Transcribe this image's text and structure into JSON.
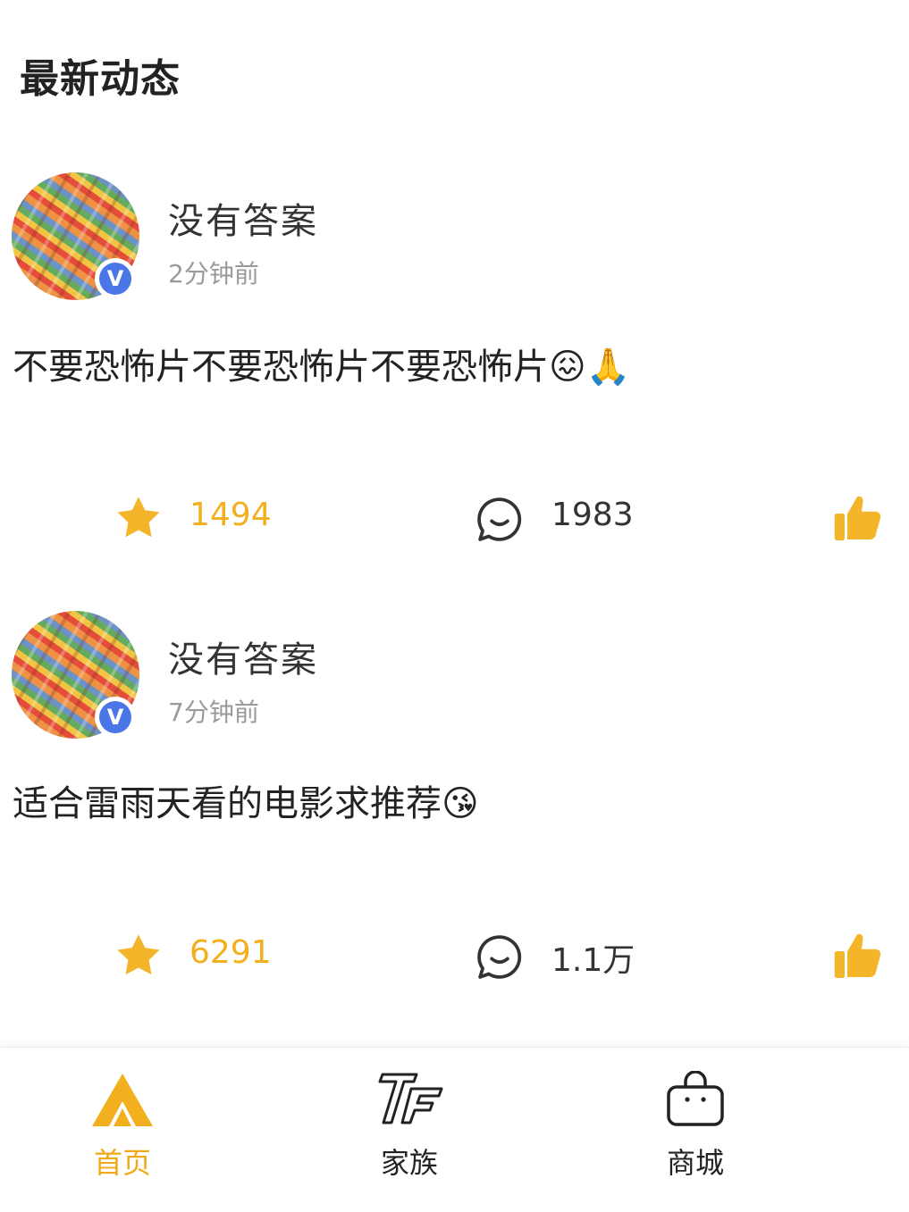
{
  "header": {
    "title": "最新动态"
  },
  "posts": [
    {
      "username": "没有答案",
      "time": "2分钟前",
      "text": "不要恐怖片不要恐怖片不要恐怖片😖🙏",
      "likes": "1494",
      "comments": "1983"
    },
    {
      "username": "没有答案",
      "time": "7分钟前",
      "text": "适合雷雨天看的电影求推荐😘",
      "likes": "6291",
      "comments": "1.1万"
    }
  ],
  "nav": [
    {
      "label": "首页",
      "icon": "home-triangle-icon",
      "active": true
    },
    {
      "label": "家族",
      "icon": "tf-logo-icon",
      "active": false
    },
    {
      "label": "商城",
      "icon": "shopping-bag-icon",
      "active": false
    }
  ],
  "badge": {
    "verified_mark": "V"
  },
  "colors": {
    "accent": "#f2b01e",
    "verified": "#4a76e8",
    "text": "#222222",
    "muted": "#9a9a9a"
  }
}
